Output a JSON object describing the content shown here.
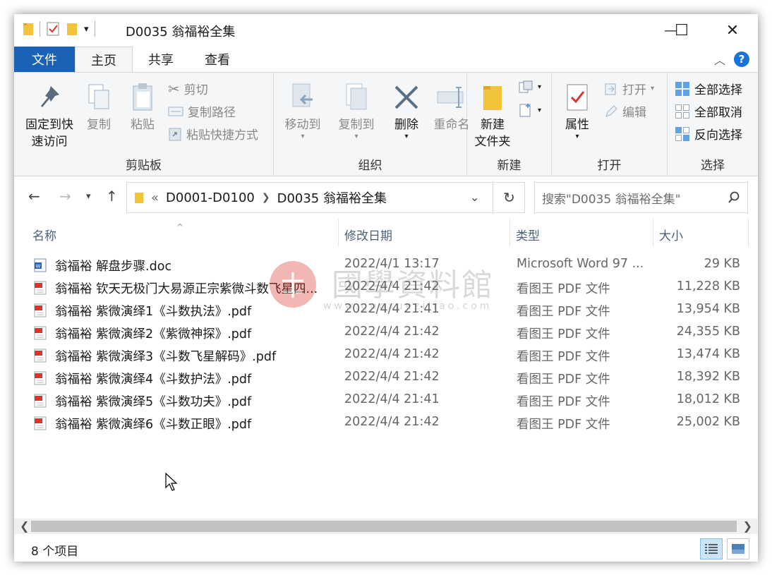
{
  "window": {
    "title": "D0035 翁福裕全集",
    "minimize_glyph": "—",
    "maximize_glyph": "☐",
    "close_glyph": "✕"
  },
  "tabs": [
    "文件",
    "主页",
    "共享",
    "查看"
  ],
  "ribbon": {
    "clipboard": {
      "group_label": "剪贴板",
      "pin_label_1": "固定到快",
      "pin_label_2": "速访问",
      "copy_label": "复制",
      "paste_label": "粘贴",
      "cut_label": "剪切",
      "copy_path_label": "复制路径",
      "paste_shortcut_label": "粘贴快捷方式"
    },
    "organize": {
      "group_label": "组织",
      "move_to_label": "移动到",
      "copy_to_label": "复制到",
      "delete_label": "删除",
      "rename_label": "重命名"
    },
    "new": {
      "group_label": "新建",
      "new_folder_label_1": "新建",
      "new_folder_label_2": "文件夹"
    },
    "open": {
      "group_label": "打开",
      "properties_label": "属性",
      "open_label": "打开",
      "edit_label": "编辑"
    },
    "select": {
      "group_label": "选择",
      "select_all_label": "全部选择",
      "select_none_label": "全部取消",
      "invert_label": "反向选择"
    }
  },
  "address": {
    "overflow": "«",
    "crumb1": "D0001-D0100",
    "crumb2": "D0035 翁福裕全集",
    "search_placeholder": "搜索\"D0035 翁福裕全集\""
  },
  "columns": {
    "name": "名称",
    "modified": "修改日期",
    "type": "类型",
    "size": "大小"
  },
  "files": [
    {
      "name": "翁福裕 解盘步骤.doc",
      "date": "2022/4/1 13:17",
      "type": "Microsoft Word 97 ...",
      "size": "29 KB",
      "kind": "doc"
    },
    {
      "name": "翁福裕 钦天无极门大易源正宗紫微斗数飞星四...",
      "date": "2022/4/4 21:42",
      "type": "看图王 PDF 文件",
      "size": "11,228 KB",
      "kind": "pdf"
    },
    {
      "name": "翁福裕 紫微演绎1《斗数执法》.pdf",
      "date": "2022/4/4 21:41",
      "type": "看图王 PDF 文件",
      "size": "13,954 KB",
      "kind": "pdf"
    },
    {
      "name": "翁福裕 紫微演绎2《紫微神探》.pdf",
      "date": "2022/4/4 21:42",
      "type": "看图王 PDF 文件",
      "size": "24,355 KB",
      "kind": "pdf"
    },
    {
      "name": "翁福裕 紫微演绎3《斗数飞星解码》.pdf",
      "date": "2022/4/4 21:42",
      "type": "看图王 PDF 文件",
      "size": "13,474 KB",
      "kind": "pdf"
    },
    {
      "name": "翁福裕 紫微演绎4《斗数护法》.pdf",
      "date": "2022/4/4 21:42",
      "type": "看图王 PDF 文件",
      "size": "18,392 KB",
      "kind": "pdf"
    },
    {
      "name": "翁福裕 紫微演绎5《斗数功夫》.pdf",
      "date": "2022/4/4 21:41",
      "type": "看图王 PDF 文件",
      "size": "18,012 KB",
      "kind": "pdf"
    },
    {
      "name": "翁福裕 紫微演绎6《斗数正眼》.pdf",
      "date": "2022/4/4 21:42",
      "type": "看图王 PDF 文件",
      "size": "25,002 KB",
      "kind": "pdf"
    }
  ],
  "watermark": {
    "title": "國學資料館",
    "url": "www.guoxueziliao.com"
  },
  "status": {
    "item_count": "8 个项目"
  },
  "colors": {
    "file_tab": "#1a62b6",
    "folder": "#f3c33a",
    "pdf_red": "#d9342b",
    "accent_blue": "#1a74d8"
  }
}
